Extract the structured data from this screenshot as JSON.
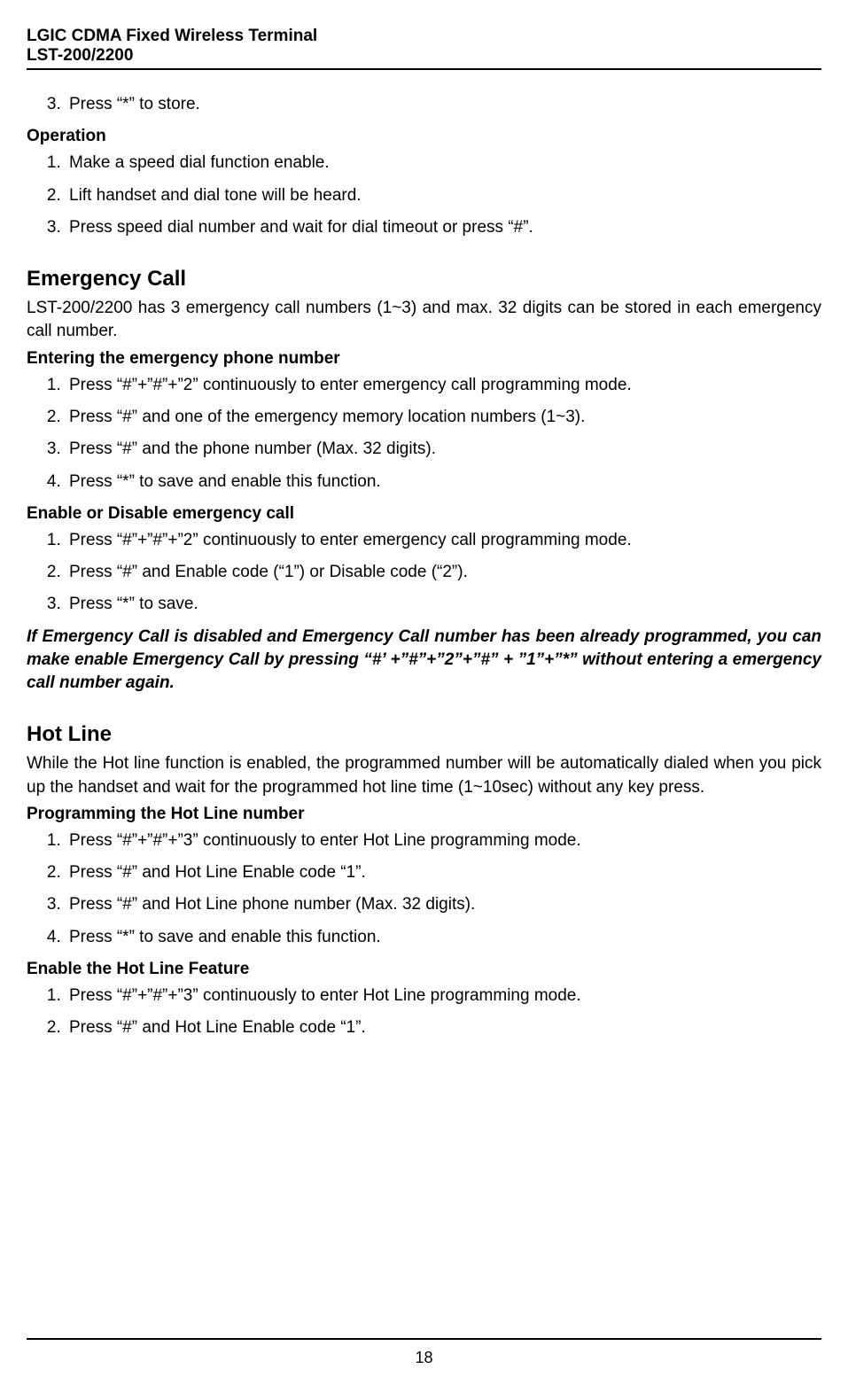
{
  "header": {
    "line1": "LGIC CDMA Fixed Wireless Terminal",
    "line2": "LST-200/2200"
  },
  "sec0": {
    "list": [
      "Press “*” to store."
    ],
    "start": 3
  },
  "operation": {
    "title": "Operation",
    "list": [
      "Make a speed dial function enable.",
      "Lift handset and dial tone will be heard.",
      "Press speed dial number and wait for dial timeout or press “#”."
    ]
  },
  "emergency": {
    "title": "Emergency Call",
    "intro": "LST-200/2200 has 3 emergency call numbers (1~3) and max. 32 digits can be stored in each emergency call number.",
    "sub1_title": "Entering the emergency phone number",
    "sub1_list": [
      "Press “#”+”#”+”2” continuously to enter emergency call programming mode.",
      "Press “#” and one of the emergency memory location numbers (1~3).",
      "Press “#” and the phone number (Max. 32 digits).",
      "Press “*” to save and enable this function."
    ],
    "sub2_title": "Enable or Disable emergency call",
    "sub2_list": [
      "Press “#”+”#”+”2” continuously to enter emergency call programming mode.",
      "Press “#” and Enable code (“1”) or Disable code (“2”).",
      "Press “*” to save."
    ],
    "note": "If Emergency Call is disabled and Emergency Call number has been already programmed, you can make enable Emergency Call by pressing “#’ +”#”+”2”+”#” + ”1”+”*” without entering a emergency call number again."
  },
  "hotline": {
    "title": "Hot Line",
    "intro": "While the Hot line function is enabled, the programmed number will be automatically dialed when you pick up the handset and wait for the programmed hot line time (1~10sec) without any key press.",
    "sub1_title": "Programming the Hot Line number",
    "sub1_list": [
      "Press “#”+”#”+”3” continuously to enter Hot Line programming mode.",
      "Press “#” and Hot Line Enable code “1”.",
      "Press “#” and Hot Line phone number (Max. 32 digits).",
      "Press “*” to save and enable this function."
    ],
    "sub2_title": "Enable the Hot Line Feature",
    "sub2_list": [
      "Press “#”+”#”+”3” continuously to enter Hot Line programming mode.",
      "Press “#” and Hot Line Enable code “1”."
    ]
  },
  "page_number": "18"
}
